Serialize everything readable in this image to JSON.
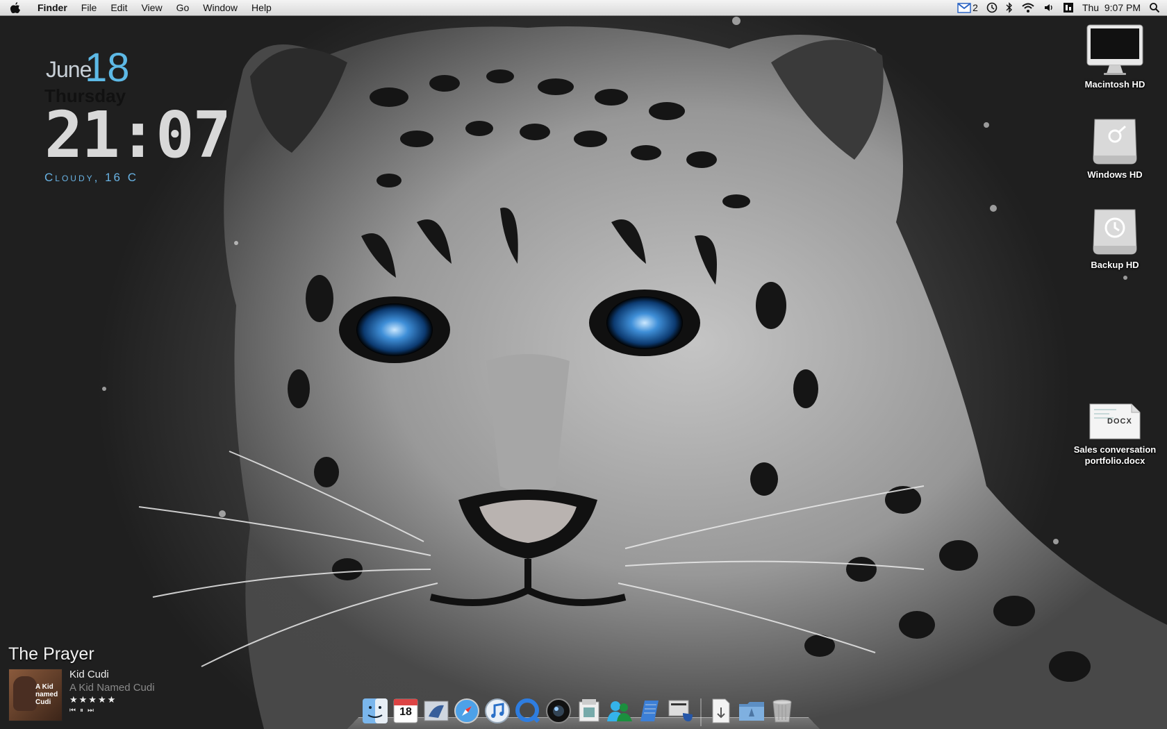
{
  "menubar": {
    "app_name": "Finder",
    "menus": [
      "File",
      "Edit",
      "View",
      "Go",
      "Window",
      "Help"
    ],
    "mail_count": "2",
    "clock": "Thu  9:07 PM"
  },
  "clock_widget": {
    "month": "June",
    "day": "18",
    "weekday": "Thursday",
    "time": "21:07",
    "weather": "Cloudy, 16 C"
  },
  "desktop_icons": [
    {
      "label": "Macintosh HD",
      "icon": "imac-icon"
    },
    {
      "label": "Windows HD",
      "icon": "external-drive-icon"
    },
    {
      "label": "Backup HD",
      "icon": "time-machine-drive-icon"
    },
    {
      "label": "Sales conversation portfolio.docx",
      "line1": "Sales conversation",
      "line2": "portfolio.docx",
      "icon": "docx-file-icon",
      "badge": "DOCX"
    }
  ],
  "now_playing": {
    "title": "The Prayer",
    "artist": "Kid Cudi",
    "album": "A Kid Named Cudi",
    "cover_text": "A Kid named Cudi",
    "rating_stars": 5,
    "stars": "★★★★★"
  },
  "dock": {
    "items": [
      "finder-icon",
      "ical-icon",
      "mail-icon",
      "safari-icon",
      "itunes-icon",
      "quicktime-icon",
      "camera-icon",
      "preview-icon",
      "ichat-icon",
      "textedit-icon",
      "news-icon",
      "downloads-stack-icon",
      "applications-folder-icon",
      "trash-icon"
    ],
    "ical_day": "18"
  },
  "colors": {
    "accent_blue": "#5db9e6",
    "menubar": "#e6e6e6"
  }
}
